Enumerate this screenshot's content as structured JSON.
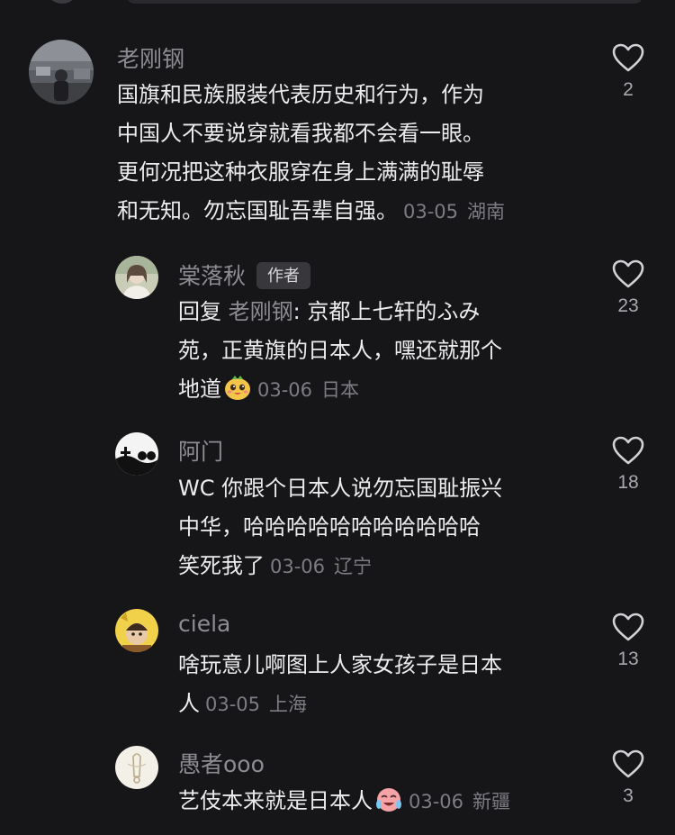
{
  "comments": [
    {
      "author": "老刚钢",
      "lines": [
        "国旗和民族服装代表历史和行为，作为",
        "中国人不要说穿就看我都不会看一眼。",
        "更何况把这种衣服穿在身上满满的耻辱",
        "和无知。勿忘国耻吾辈自强。"
      ],
      "date": "03-05",
      "location": "湖南",
      "likes": "2"
    },
    {
      "author": "棠落秋",
      "author_tag": "作者",
      "reply_word": "回复",
      "reply_target": "老刚钢",
      "lines": [
        ": 京都上七轩的ふみ",
        "苑，正黄旗的日本人，嘿还就那个",
        "地道"
      ],
      "emoji": "smiling-face-emoji",
      "date": "03-06",
      "location": "日本",
      "likes": "23"
    },
    {
      "author": "阿门",
      "lines": [
        "WC 你跟个日本人说勿忘国耻振兴",
        "中华，哈哈哈哈哈哈哈哈哈哈哈",
        "笑死我了"
      ],
      "date": "03-06",
      "location": "辽宁",
      "likes": "18"
    },
    {
      "author": "ciela",
      "lines": [
        "啥玩意儿啊图上人家女孩子是日本",
        "人"
      ],
      "date": "03-05",
      "location": "上海",
      "likes": "13"
    },
    {
      "author": "愚者ooo",
      "lines": [
        "艺伎本来就是日本人"
      ],
      "emoji": "crying-laughing-emoji",
      "date": "03-06",
      "location": "新疆",
      "likes": "3"
    }
  ],
  "colors": {
    "background": "#161619",
    "text": "#ececef",
    "muted": "#8c8c93",
    "tag_bg": "#37373c"
  }
}
